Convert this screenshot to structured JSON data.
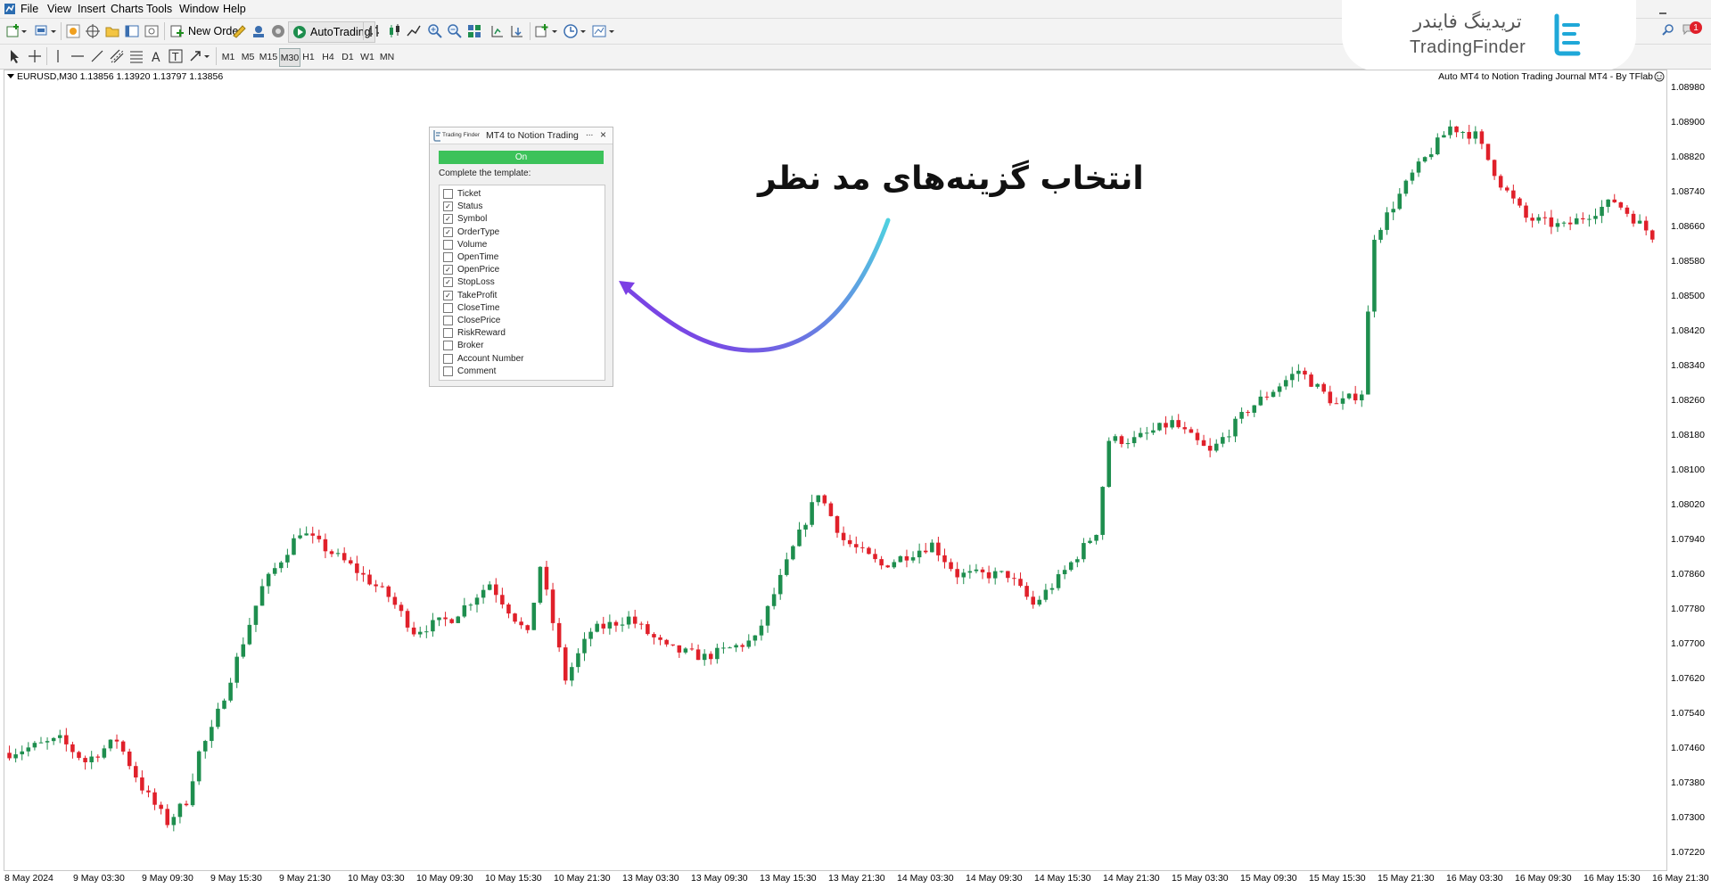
{
  "menu": [
    "File",
    "View",
    "Insert",
    "Charts",
    "Tools",
    "Window",
    "Help"
  ],
  "toolbar": {
    "new_order": "New Order",
    "auto_trading": "AutoTrading"
  },
  "timeframes": [
    "M1",
    "M5",
    "M15",
    "M30",
    "H1",
    "H4",
    "D1",
    "W1",
    "MN"
  ],
  "active_timeframe": "M30",
  "notification_count": "1",
  "logo": {
    "persian": "تریدینگ فایندر",
    "english": "TradingFinder",
    "color": "#1fa8d8"
  },
  "chart": {
    "symbol_info": "EURUSD,M30  1.13856 1.13920 1.13797 1.13856",
    "indicator_name": "Auto MT4 to Notion Trading Journal MT4 - By TFlab",
    "up_color": "#1e8e4e",
    "down_color": "#e0202a"
  },
  "chart_data": {
    "type": "candlestick",
    "symbol": "EURUSD",
    "timeframe": "M30",
    "ylim": [
      1.0718,
      1.0902
    ],
    "price_ticks": [
      "1.08980",
      "1.08900",
      "1.08820",
      "1.08740",
      "1.08660",
      "1.08580",
      "1.08500",
      "1.08420",
      "1.08340",
      "1.08260",
      "1.08180",
      "1.08100",
      "1.08020",
      "1.07940",
      "1.07860",
      "1.07780",
      "1.07700",
      "1.07620",
      "1.07540",
      "1.07460",
      "1.07380",
      "1.07300",
      "1.07220"
    ],
    "time_ticks": [
      "8 May 2024",
      "9 May 03:30",
      "9 May 09:30",
      "9 May 15:30",
      "9 May 21:30",
      "10 May 03:30",
      "10 May 09:30",
      "10 May 15:30",
      "10 May 21:30",
      "13 May 03:30",
      "13 May 09:30",
      "13 May 15:30",
      "13 May 21:30",
      "14 May 03:30",
      "14 May 09:30",
      "14 May 15:30",
      "14 May 21:30",
      "15 May 03:30",
      "15 May 09:30",
      "15 May 15:30",
      "15 May 21:30",
      "16 May 03:30",
      "16 May 09:30",
      "16 May 15:30",
      "16 May 21:30"
    ],
    "close_path": [
      [
        0,
        1.0745
      ],
      [
        8,
        1.0748
      ],
      [
        12,
        1.0743
      ],
      [
        17,
        1.0748
      ],
      [
        21,
        1.0737
      ],
      [
        25,
        1.0729
      ],
      [
        28,
        1.0734
      ],
      [
        30,
        1.0745
      ],
      [
        32,
        1.075
      ],
      [
        40,
        1.0783
      ],
      [
        46,
        1.0796
      ],
      [
        54,
        1.0788
      ],
      [
        60,
        1.0781
      ],
      [
        64,
        1.0773
      ],
      [
        70,
        1.0776
      ],
      [
        76,
        1.0784
      ],
      [
        82,
        1.0772
      ],
      [
        84,
        1.0788
      ],
      [
        88,
        1.0762
      ],
      [
        92,
        1.0773
      ],
      [
        98,
        1.0776
      ],
      [
        104,
        1.0769
      ],
      [
        110,
        1.0767
      ],
      [
        118,
        1.0771
      ],
      [
        124,
        1.0792
      ],
      [
        128,
        1.0805
      ],
      [
        132,
        1.0794
      ],
      [
        138,
        1.0788
      ],
      [
        146,
        1.0793
      ],
      [
        150,
        1.0786
      ],
      [
        158,
        1.0786
      ],
      [
        162,
        1.0779
      ],
      [
        166,
        1.0785
      ],
      [
        172,
        1.0796
      ],
      [
        174,
        1.0817
      ],
      [
        178,
        1.0817
      ],
      [
        184,
        1.0821
      ],
      [
        190,
        1.0814
      ],
      [
        196,
        1.0824
      ],
      [
        204,
        1.0833
      ],
      [
        210,
        1.0825
      ],
      [
        214,
        1.0828
      ],
      [
        216,
        1.0864
      ],
      [
        222,
        1.0878
      ],
      [
        228,
        1.0889
      ],
      [
        232,
        1.0887
      ],
      [
        236,
        1.0876
      ],
      [
        240,
        1.0868
      ],
      [
        246,
        1.0866
      ],
      [
        254,
        1.0872
      ],
      [
        260,
        1.0864
      ]
    ]
  },
  "panel": {
    "brand": "Trading Finder",
    "title": "MT4 to Notion Trading",
    "minimize": "...",
    "close": "×",
    "on_label": "On",
    "template_label": "Complete the template:",
    "items": [
      {
        "label": "Ticket",
        "checked": false
      },
      {
        "label": "Status",
        "checked": true
      },
      {
        "label": "Symbol",
        "checked": true
      },
      {
        "label": "OrderType",
        "checked": true
      },
      {
        "label": "Volume",
        "checked": false
      },
      {
        "label": "OpenTime",
        "checked": false
      },
      {
        "label": "OpenPrice",
        "checked": true
      },
      {
        "label": "StopLoss",
        "checked": true
      },
      {
        "label": "TakeProfit",
        "checked": true
      },
      {
        "label": "CloseTime",
        "checked": false
      },
      {
        "label": "ClosePrice",
        "checked": false
      },
      {
        "label": "RiskReward",
        "checked": false
      },
      {
        "label": "Broker",
        "checked": false
      },
      {
        "label": "Account Number",
        "checked": false
      },
      {
        "label": "Comment",
        "checked": false
      }
    ]
  },
  "annotation": {
    "text": "انتخاب گزینه‌های مد نظر",
    "arrow_start_color": "#4fd1e0",
    "arrow_end_color": "#7b3fe4"
  }
}
